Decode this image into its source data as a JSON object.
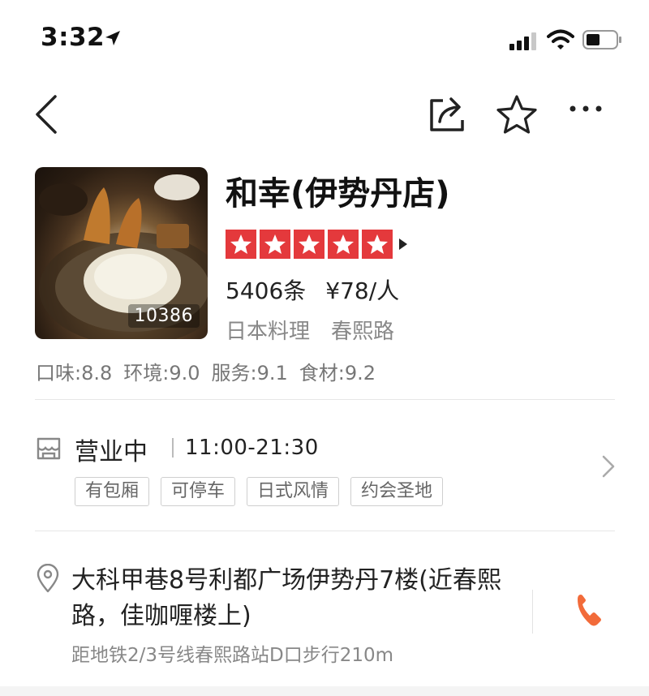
{
  "status_bar": {
    "time": "3:32",
    "icons": [
      "location-arrow-icon",
      "cellular-signal-icon",
      "wifi-icon",
      "battery-icon"
    ]
  },
  "nav": {
    "icons": [
      "back-chevron-icon",
      "share-icon",
      "favorite-star-icon",
      "more-icon"
    ]
  },
  "shop": {
    "name": "和幸(伊势丹店)",
    "photo_count": "10386",
    "rating_stars": 5,
    "reviews": "5406条",
    "price": "¥78/人",
    "category": "日本料理",
    "district": "春熙路",
    "scores": {
      "taste": "口味:8.8",
      "environment": "环境:9.0",
      "service": "服务:9.1",
      "ingredients": "食材:9.2"
    }
  },
  "hours": {
    "status": "营业中",
    "time_range": "11:00-21:30",
    "tags": [
      "有包厢",
      "可停车",
      "日式风情",
      "约会圣地"
    ]
  },
  "address": {
    "text": "大科甲巷8号利都广场伊势丹7楼(近春熙路，佳咖喱楼上)",
    "subway": "距地铁2/3号线春熙路站D口步行210m"
  },
  "colors": {
    "star_red": "#e4393c",
    "phone_orange": "#f26b3a",
    "muted_text": "#888888"
  }
}
